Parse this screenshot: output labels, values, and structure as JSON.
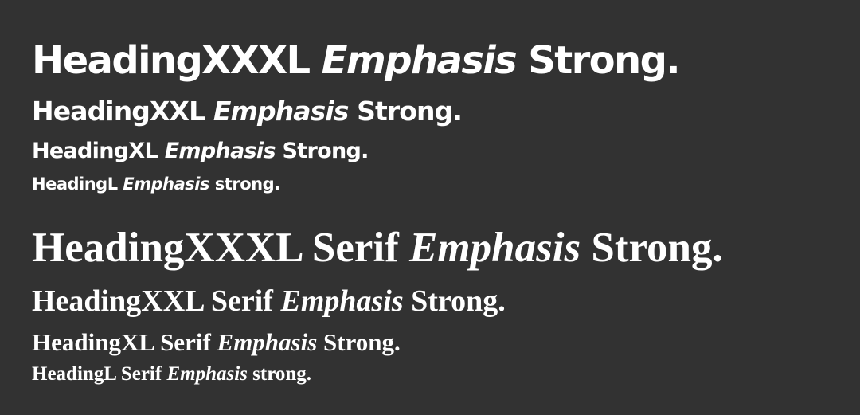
{
  "sans": [
    {
      "name": "HeadingXXXL",
      "emphasis": "Emphasis",
      "strong": "Strong."
    },
    {
      "name": "HeadingXXL",
      "emphasis": "Emphasis",
      "strong": "Strong."
    },
    {
      "name": "HeadingXL",
      "emphasis": "Emphasis",
      "strong": "Strong."
    },
    {
      "name": "HeadingL",
      "emphasis": "Emphasis",
      "strong": "strong."
    }
  ],
  "serif": [
    {
      "name": "HeadingXXXL Serif",
      "emphasis": "Emphasis",
      "strong": "Strong."
    },
    {
      "name": "HeadingXXL Serif",
      "emphasis": "Emphasis",
      "strong": "Strong."
    },
    {
      "name": "HeadingXL Serif",
      "emphasis": "Emphasis",
      "strong": "Strong."
    },
    {
      "name": "HeadingL Serif",
      "emphasis": "Emphasis",
      "strong": "strong."
    }
  ],
  "colors": {
    "background": "#323232",
    "text": "#ffffff"
  }
}
